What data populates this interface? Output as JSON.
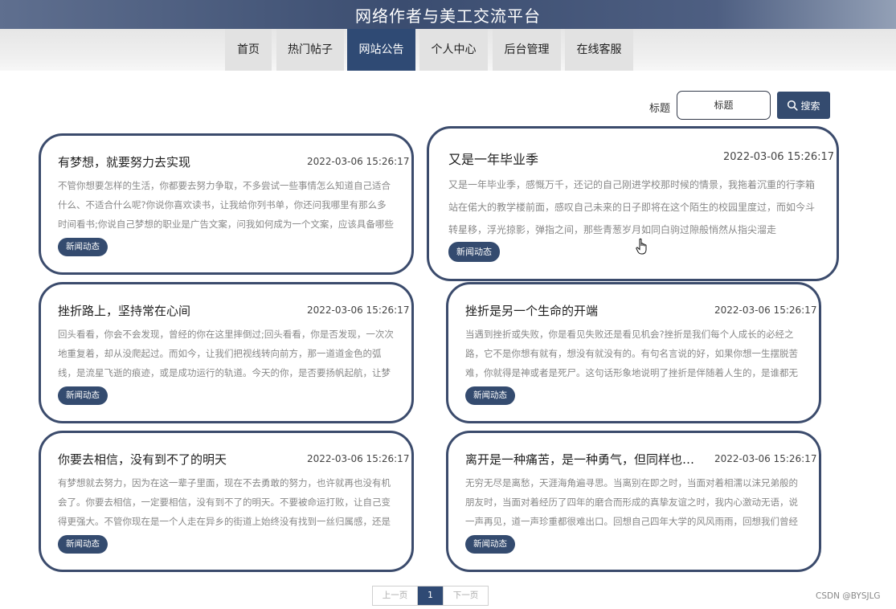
{
  "header": {
    "title": "网络作者与美工交流平台"
  },
  "nav": {
    "items": [
      {
        "label": "首页"
      },
      {
        "label": "热门帖子"
      },
      {
        "label": "网站公告"
      },
      {
        "label": "个人中心"
      },
      {
        "label": "后台管理"
      },
      {
        "label": "在线客服"
      }
    ],
    "active": "网站公告"
  },
  "search": {
    "label": "标题",
    "placeholder": "标题",
    "button_label": "搜索",
    "icon": "search-icon"
  },
  "posts": [
    {
      "title": "有梦想，就要努力去实现",
      "date": "2022-03-06 15:26:17",
      "excerpt": "不管你想要怎样的生活，你都要去努力争取，不多尝试一些事情怎么知道自己适合什么、不适合什么呢?你说你喜欢读书，让我给你列书单，你还问我哪里有那么多时间看书;你说自己梦想的职业是广告文案，问我如何成为一个文案，应该具备哪些素质",
      "tag": "新闻动态"
    },
    {
      "title": "又是一年毕业季",
      "date": "2022-03-06 15:26:17",
      "excerpt": "又是一年毕业季，感慨万千，还记的自己刚进学校那时候的情景，我拖着沉重的行李箱站在偌大的教学楼前面，感叹自己未来的日子即将在这个陌生的校园里度过，而如今斗转星移，浮光掠影，弹指之间，那些青葱岁月如同白驹过隙般悄然从指尖溜走",
      "tag": "新闻动态"
    },
    {
      "title": "挫折路上，坚持常在心间",
      "date": "2022-03-06 15:26:17",
      "excerpt": "回头看看，你会不会发现，曾经的你在这里摔倒过;回头看看，你是否发现，一次次地重复着，却从没爬起过。而如今，让我们把视线转向前方，那一道道金色的弧线，是流星飞逝的痕迹，或是成功运行的轨道。今天的你，是否要扬帆起航，让梦想照进现实",
      "tag": "新闻动态"
    },
    {
      "title": "挫折是另一个生命的开端",
      "date": "2022-03-06 15:26:17",
      "excerpt": "当遇到挫折或失败，你是看见失败还是看见机会?挫折是我们每个人成长的必经之路，它不是你想有就有，想没有就没有的。有句名言说的好，如果你想一生摆脱苦难，你就得是神或者是死尸。这句话形象地说明了挫折是伴随着人生的，是谁都无法逃避的",
      "tag": "新闻动态"
    },
    {
      "title": "你要去相信，没有到不了的明天",
      "date": "2022-03-06 15:26:17",
      "excerpt": "有梦想就去努力，因为在这一辈子里面，现在不去勇敢的努力，也许就再也没有机会了。你要去相信，一定要相信，没有到不了的明天。不要被命运打败，让自己变得更强大。不管你现在是一个人走在异乡的街道上始终没有找到一丝归属感，还是",
      "tag": "新闻动态"
    },
    {
      "title": "离开是一种痛苦，是一种勇气，但同样也是一种希望",
      "date": "2022-03-06 15:26:17",
      "excerpt": "无穷无尽是离愁，天涯海角遍寻思。当离别在即之时，当面对着相濡以沫兄弟般的朋友时，当面对着经历了四年的磨合而形成的真挚友谊之时，我内心激动无语，说一声再见，道一声珍重都很难出口。回想自己四年大学的风风雨雨，回想我们曾经的点点滴滴",
      "tag": "新闻动态"
    }
  ],
  "pagination": {
    "prev": "上一页",
    "current": "1",
    "next": "下一页"
  },
  "watermark": "CSDN @BYSJLG",
  "colors": {
    "primary": "#344b6f",
    "card_border": "#3b4b6c",
    "nav_active": "#2f4a74"
  }
}
